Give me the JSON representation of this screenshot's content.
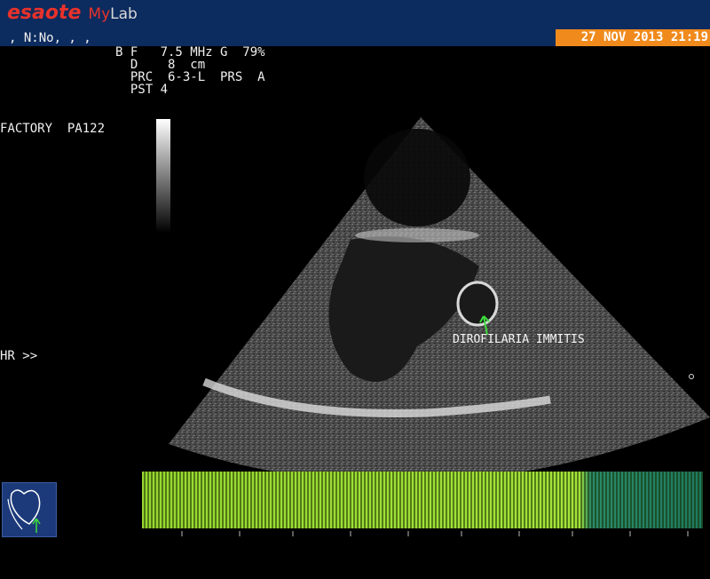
{
  "header": {
    "brand_e": "esaote",
    "brand_my": "My",
    "brand_lab": "Lab",
    "patient": ", N:No, , ,",
    "datetime": "27 NOV 2013 21:19"
  },
  "params": {
    "line1": "B F   7.5 MHz G  79%",
    "line2": "  D    8  cm",
    "line3": "  PRC  6-3-L  PRS  A",
    "line4": "  PST 4"
  },
  "side": {
    "factory": "FACTORY  PA122",
    "hr": "HR >>"
  },
  "image": {
    "annotation": "DIROFILARIA IMMITIS"
  },
  "colors": {
    "header_bg": "#0c2b5e",
    "brand": "#e8322b",
    "datetime_bg": "#f08a1c",
    "ecg_green": "#a4e43a",
    "ecg_teal": "#1e7a5e",
    "arrow": "#3ddc3d"
  },
  "icons": {
    "probe": "heart-probe-icon",
    "pointer": "green-arrow-icon"
  }
}
